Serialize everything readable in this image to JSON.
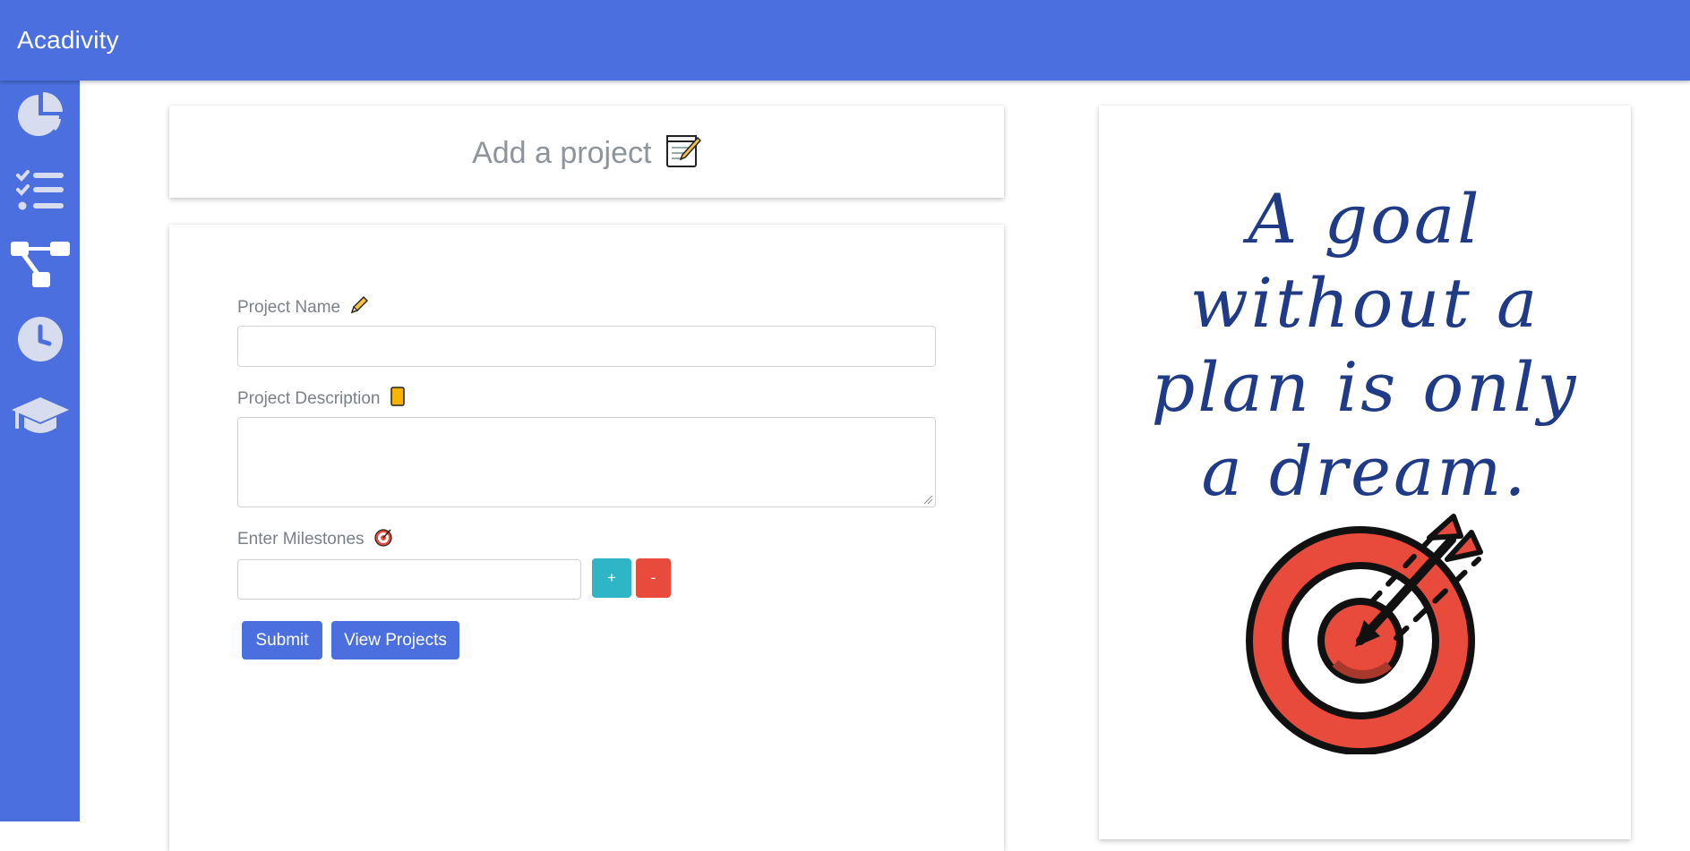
{
  "app": {
    "title": "Acadivity"
  },
  "sidebar": {
    "items": [
      {
        "name": "dashboard",
        "icon": "pie-chart-icon"
      },
      {
        "name": "tasks",
        "icon": "checklist-icon"
      },
      {
        "name": "projects",
        "icon": "sitemap-icon"
      },
      {
        "name": "timer",
        "icon": "clock-icon"
      },
      {
        "name": "courses",
        "icon": "graduation-cap-icon"
      }
    ]
  },
  "header": {
    "title": "Add a project",
    "icon": "memo-icon"
  },
  "form": {
    "project_name": {
      "label": "Project Name",
      "icon": "pencil-icon",
      "value": ""
    },
    "project_description": {
      "label": "Project Description",
      "icon": "notebook-icon",
      "value": ""
    },
    "milestones": {
      "label": "Enter Milestones",
      "icon": "target-icon",
      "value": ""
    },
    "add_label": "+",
    "remove_label": "-",
    "submit_label": "Submit",
    "view_label": "View Projects"
  },
  "quote": {
    "lines": [
      "A goal",
      "without a",
      "plan is only",
      "a dream."
    ]
  },
  "colors": {
    "primary": "#4b6fde",
    "info": "#2fb6c6",
    "danger": "#e84a3c",
    "quote_text": "#1f3a86",
    "sidebar_icon": "#d8dcef"
  }
}
